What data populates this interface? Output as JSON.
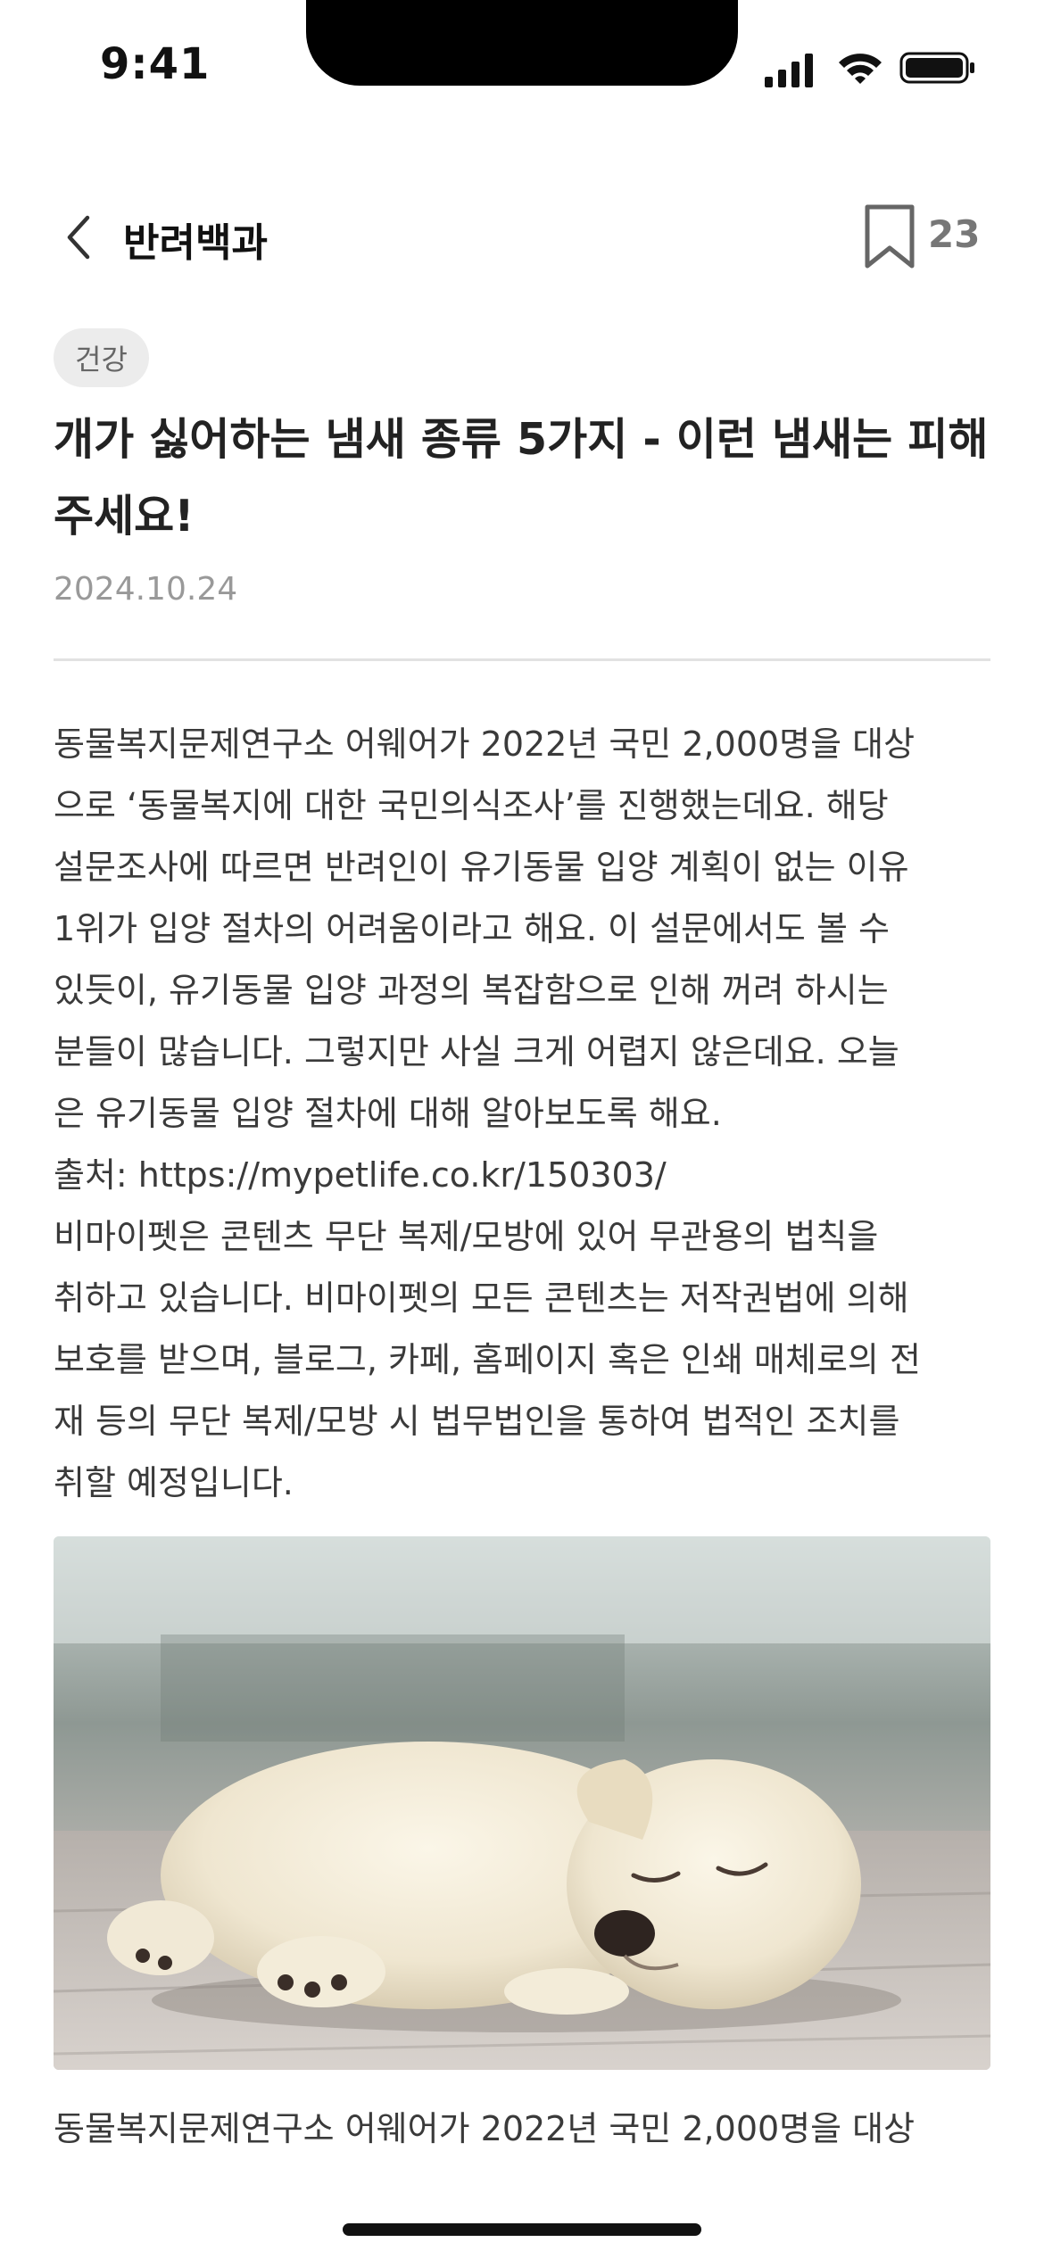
{
  "status_bar": {
    "time": "9:41"
  },
  "header": {
    "title": "반려백과",
    "bookmark_count": "23"
  },
  "article": {
    "category": "건강",
    "title": "개가 싫어하는 냄새 종류 5가지 - 이런 냄새는 피해 주세요!",
    "date": "2024.10.24",
    "body_lines": [
      "동물복지문제연구소 어웨어가 2022년 국민 2,000명을 대상",
      "으로 ‘동물복지에 대한 국민의식조사’를 진행했는데요. 해당",
      "설문조사에 따르면 반려인이 유기동물 입양 계획이 없는 이유",
      "1위가 입양 절차의 어려움이라고 해요. 이 설문에서도 볼 수",
      "있듯이, 유기동물 입양 과정의 복잡함으로 인해 꺼려 하시는",
      "분들이 많습니다. 그렇지만 사실 크게 어렵지 않은데요. 오늘",
      "은 유기동물 입양 절차에 대해 알아보도록 해요.",
      "출처: https://mypetlife.co.kr/150303/",
      "비마이펫은 콘텐츠 무단 복제/모방에 있어 무관용의 법칙을",
      "취하고 있습니다. 비마이펫의 모든 콘텐츠는 저작권법에 의해",
      "보호를 받으며, 블로그, 카페, 홈페이지 혹은 인쇄 매체로의 전",
      "재 등의 무단 복제/모방 시 법무법인을 통하여 법적인 조치를",
      "취할 예정입니다."
    ],
    "caption": "동물복지문제연구소 어웨어가 2022년 국민 2,000명을 대상"
  },
  "icons": {
    "back": "chevron-left-icon",
    "bookmark": "bookmark-icon",
    "signal": "cellular-signal-icon",
    "wifi": "wifi-icon",
    "battery": "battery-icon"
  },
  "colors": {
    "chip_bg": "#ececec",
    "text_primary": "#222222",
    "text_muted": "#999999",
    "divider": "#e2e2e2"
  }
}
